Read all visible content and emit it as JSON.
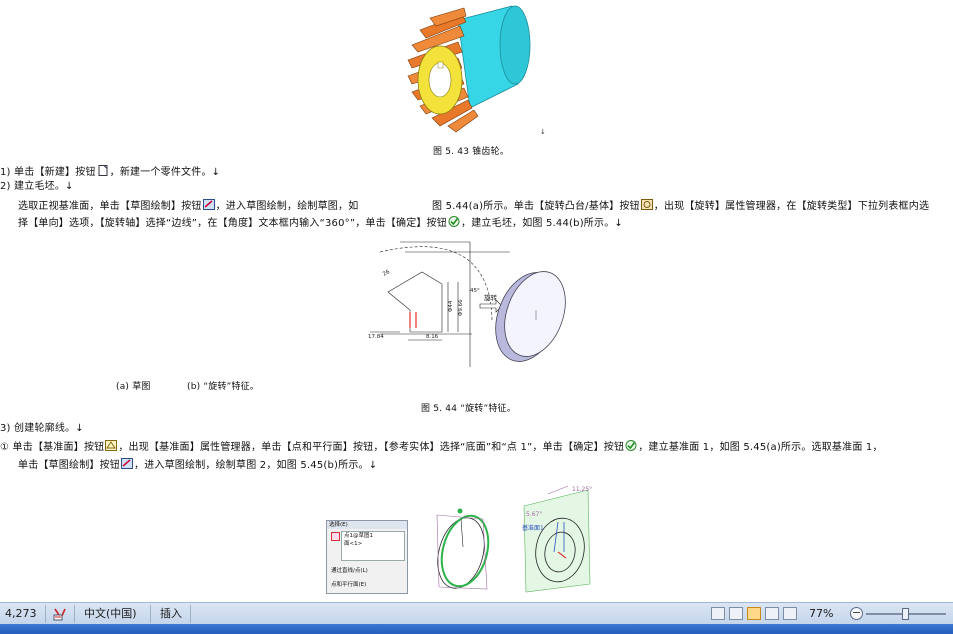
{
  "document": {
    "fig543_caption": "图 5. 43   锥齿轮。",
    "fig543_mark": "↓",
    "step1": "1)  单击【新建】按钮",
    "step1_rest": "，新建一个零件文件。↓",
    "step2": "2)  建立毛坯。↓",
    "step2_line1a": "选取正视基准面，单击【草图绘制】按钮",
    "step2_line1b": "，进入草图绘制，绘制草图，如",
    "step2_line1c": "图 5.44(a)所示。单击【旋转凸台/基体】按钮",
    "step2_line1d": "，出现【旋转】属性管理器，在【旋转类型】下拉列表框内选",
    "step2_line2a": "择【单向】选项，【旋转轴】选择“边线”，在【角度】文本框内输入“360°”，单击【确定】按钮",
    "step2_line2b": "，建立毛坯，如图 5.44(b)所示。↓",
    "fig544_sub_a": "(a) 草图",
    "fig544_sub_b": "(b) “旋转”特征。",
    "fig544_caption": "图 5. 44   “旋转”特征。",
    "fig544_dims": {
      "d1": "26",
      "d2": "45°",
      "d3": "Φ44",
      "d4": "Φ9.66",
      "d5": "17.84",
      "d6": "8.16",
      "rotate_label": "旋转"
    },
    "step3": "3)  创建轮廓线。↓",
    "step3_1a": "①  单击【基准面】按钮",
    "step3_1b": "，出现【基准面】属性管理器，单击【点和平行面】按钮，【参考实体】选择“底面”和“点 1”，单击【确定】按钮",
    "step3_1c": "，建立基准面 1，如图 5.45(a)所示。选取基准面 1，",
    "step3_2a": "单击【草图绘制】按钮",
    "step3_2b": "，进入草图绘制，绘制草图 2，如图 5.45(b)所示。↓",
    "fig545_panel": {
      "title": "选择(E)",
      "item1": "点1@草图1",
      "item2": "面<1>",
      "opt1": "通过直线/点(L)",
      "opt2": "点和平行面(E)"
    },
    "fig545_labels": {
      "angle": "11.25°",
      "dim": "5.67°",
      "plane": "基准面1"
    }
  },
  "statusbar": {
    "count": "4,273",
    "language": "中文(中国)",
    "mode": "插入",
    "zoom": "77%"
  },
  "colors": {
    "gear_orange": "#e8782a",
    "gear_yellow": "#f2e23a",
    "hub_cyan": "#37d6e6",
    "green": "#2db34a"
  }
}
